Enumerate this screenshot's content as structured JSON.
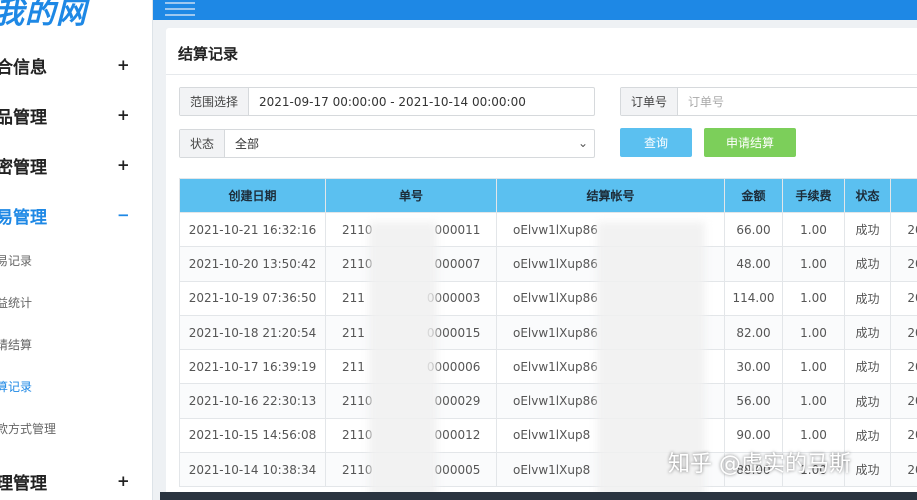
{
  "sidebar": {
    "logo": "我的网",
    "menus": [
      {
        "label": "合信息",
        "toggle": "+"
      },
      {
        "label": "品管理",
        "toggle": "+"
      },
      {
        "label": "密管理",
        "toggle": "+"
      },
      {
        "label": "易管理",
        "toggle": "−"
      },
      {
        "label": "理管理",
        "toggle": "+"
      }
    ],
    "sub_items": [
      {
        "label": "易记录"
      },
      {
        "label": "益统计"
      },
      {
        "label": "请结算"
      },
      {
        "label": "算记录"
      },
      {
        "label": "款方式管理"
      }
    ]
  },
  "panel": {
    "title": "结算记录"
  },
  "filters": {
    "range_label": "范围选择",
    "range_value": "2021-09-17 00:00:00 - 2021-10-14 00:00:00",
    "order_label": "订单号",
    "order_placeholder": "订单号",
    "status_label": "状态",
    "status_value": "全部",
    "query_button": "查询",
    "settle_button": "申请结算"
  },
  "table": {
    "headers": [
      "创建日期",
      "单号",
      "结算帐号",
      "金额",
      "手续费",
      "状态",
      ""
    ],
    "rows": [
      {
        "date": "2021-10-21 16:32:16",
        "no_head": "2110",
        "no_tail": "000011",
        "account": "oElvw1lXup86",
        "amount": "66.00",
        "fee": "1.00",
        "status": "成功",
        "extra": "20"
      },
      {
        "date": "2021-10-20 13:50:42",
        "no_head": "2110",
        "no_tail": "000007",
        "account": "oElvw1lXup86",
        "amount": "48.00",
        "fee": "1.00",
        "status": "成功",
        "extra": "20"
      },
      {
        "date": "2021-10-19 07:36:50",
        "no_head": "211",
        "no_tail": "0000003",
        "account": "oElvw1lXup86",
        "amount": "114.00",
        "fee": "1.00",
        "status": "成功",
        "extra": "20"
      },
      {
        "date": "2021-10-18 21:20:54",
        "no_head": "211",
        "no_tail": "0000015",
        "account": "oElvw1lXup86",
        "amount": "82.00",
        "fee": "1.00",
        "status": "成功",
        "extra": "20"
      },
      {
        "date": "2021-10-17 16:39:19",
        "no_head": "211",
        "no_tail": "0000006",
        "account": "oElvw1lXup86",
        "amount": "30.00",
        "fee": "1.00",
        "status": "成功",
        "extra": "20"
      },
      {
        "date": "2021-10-16 22:30:13",
        "no_head": "2110",
        "no_tail": "000029",
        "account": "oElvw1lXup86",
        "amount": "56.00",
        "fee": "1.00",
        "status": "成功",
        "extra": "20"
      },
      {
        "date": "2021-10-15 14:56:08",
        "no_head": "2110",
        "no_tail": "000012",
        "account": "oElvw1lXup8",
        "amount": "90.00",
        "fee": "1.00",
        "status": "成功",
        "extra": "20"
      },
      {
        "date": "2021-10-14 10:38:34",
        "no_head": "2110",
        "no_tail": "000005",
        "account": "oElvw1lXup8",
        "amount": "88.00",
        "fee": "1.00",
        "status": "成功",
        "extra": "20"
      }
    ]
  },
  "watermark": "知乎 @虚实的马斯",
  "colors": {
    "primary": "#1e88e5",
    "table_header": "#5bc0f0",
    "query_button": "#5bc0f0",
    "settle_button": "#7ccf5a"
  }
}
